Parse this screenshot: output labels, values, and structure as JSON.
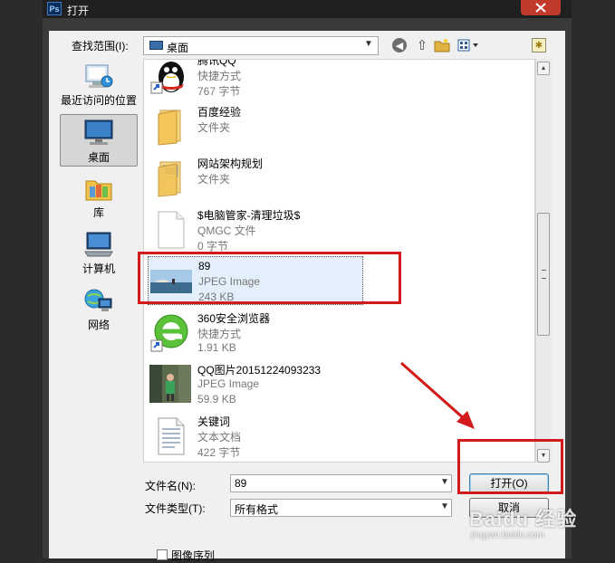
{
  "window": {
    "title": "打开",
    "app_icon_text": "Ps"
  },
  "lookin": {
    "label": "查找范围(I):",
    "value": "桌面"
  },
  "toolbar": {
    "back_icon": "back-arrow-icon",
    "up_icon": "up-folder-icon",
    "new_folder_icon": "new-folder-icon",
    "views_icon": "view-menu-icon"
  },
  "places": [
    {
      "label": "最近访问的位置",
      "icon": "recent-places-icon"
    },
    {
      "label": "桌面",
      "icon": "desktop-icon",
      "selected": true
    },
    {
      "label": "库",
      "icon": "libraries-icon"
    },
    {
      "label": "计算机",
      "icon": "computer-icon"
    },
    {
      "label": "网络",
      "icon": "network-icon"
    }
  ],
  "files": [
    {
      "name": "腾讯QQ",
      "type": "快捷方式",
      "size": "767 字节",
      "icon": "qq-penguin-icon"
    },
    {
      "name": "百度经验",
      "type": "文件夹",
      "size": "",
      "icon": "folder-icon"
    },
    {
      "name": "网站架构规划",
      "type": "文件夹",
      "size": "",
      "icon": "folder-icon"
    },
    {
      "name": "$电脑管家-清理垃圾$",
      "type": "QMGC 文件",
      "size": "0 字节",
      "icon": "blank-file-icon"
    },
    {
      "name": "89",
      "type": "JPEG Image",
      "size": "243 KB",
      "icon": "jpeg-thumbnail",
      "selected": true
    },
    {
      "name": "360安全浏览器",
      "type": "快捷方式",
      "size": "1.91 KB",
      "icon": "360-browser-icon"
    },
    {
      "name": "QQ图片20151224093233",
      "type": "JPEG Image",
      "size": "59.9 KB",
      "icon": "photo-thumbnail"
    },
    {
      "name": "关键词",
      "type": "文本文档",
      "size": "422 字节",
      "icon": "text-document-icon"
    }
  ],
  "filename": {
    "label": "文件名(N):",
    "value": "89"
  },
  "filetype": {
    "label": "文件类型(T):",
    "value": "所有格式"
  },
  "buttons": {
    "open": "打开(O)",
    "cancel": "取消"
  },
  "sequence": {
    "label": "图像序列"
  },
  "watermark": {
    "text": "Baidu 经验",
    "sub": "jingyan.baidu.com"
  },
  "colors": {
    "annotation_red": "#d21a1a",
    "selection": "#e3effa",
    "titlebar": "#202020"
  }
}
